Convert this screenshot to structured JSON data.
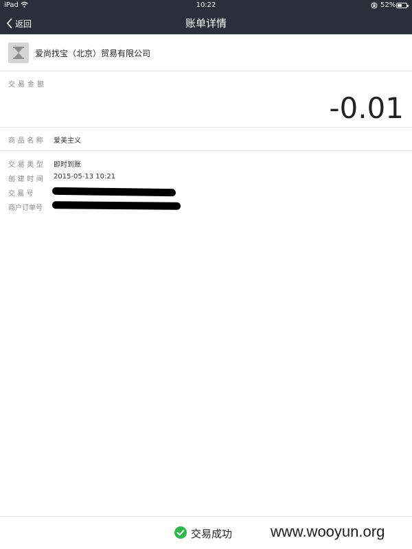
{
  "status_bar": {
    "carrier": "iPad",
    "time": "10:22",
    "battery_percent": "52%",
    "battery_level": 0.52
  },
  "nav": {
    "back_label": "返回",
    "title": "账单详情"
  },
  "merchant": {
    "name": "爱尚找宝（北京）贸易有限公司",
    "logo_icon": "hourglass-icon"
  },
  "amount": {
    "label": "交易金额",
    "value": "-0.01"
  },
  "product": {
    "label": "商品名称",
    "value": "爱美主义"
  },
  "details": {
    "type_label": "交易类型",
    "type_value": "即时到账",
    "created_label": "创建时间",
    "created_value": "2015-05-13 10:21",
    "trade_no_label": "交 易 号",
    "merchant_order_label": "商户订单号"
  },
  "footer": {
    "status_text": "交易成功",
    "status_color": "#2db84d",
    "watermark": "www.wooyun.org"
  }
}
